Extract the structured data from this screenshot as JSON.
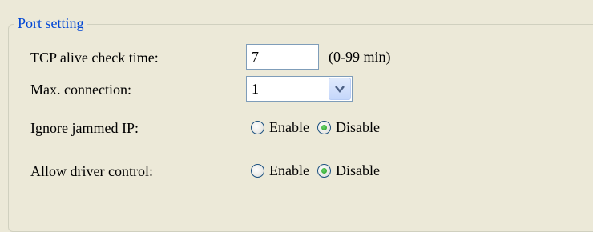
{
  "group": {
    "title": "Port setting"
  },
  "fields": {
    "tcp_alive": {
      "label": "TCP alive check time:",
      "value": "7",
      "hint": "(0-99 min)"
    },
    "max_connection": {
      "label": "Max. connection:",
      "selected": "1"
    },
    "ignore_jammed_ip": {
      "label": "Ignore jammed IP:",
      "enable_label": "Enable",
      "disable_label": "Disable",
      "selected": "Disable"
    },
    "allow_driver_control": {
      "label": "Allow driver control:",
      "enable_label": "Enable",
      "disable_label": "Disable",
      "selected": "Disable"
    }
  },
  "icons": {
    "dropdown": "chevron-down-icon"
  },
  "colors": {
    "background": "#ece9d8",
    "legend": "#0046d5",
    "radio_selected": "#21a121"
  }
}
